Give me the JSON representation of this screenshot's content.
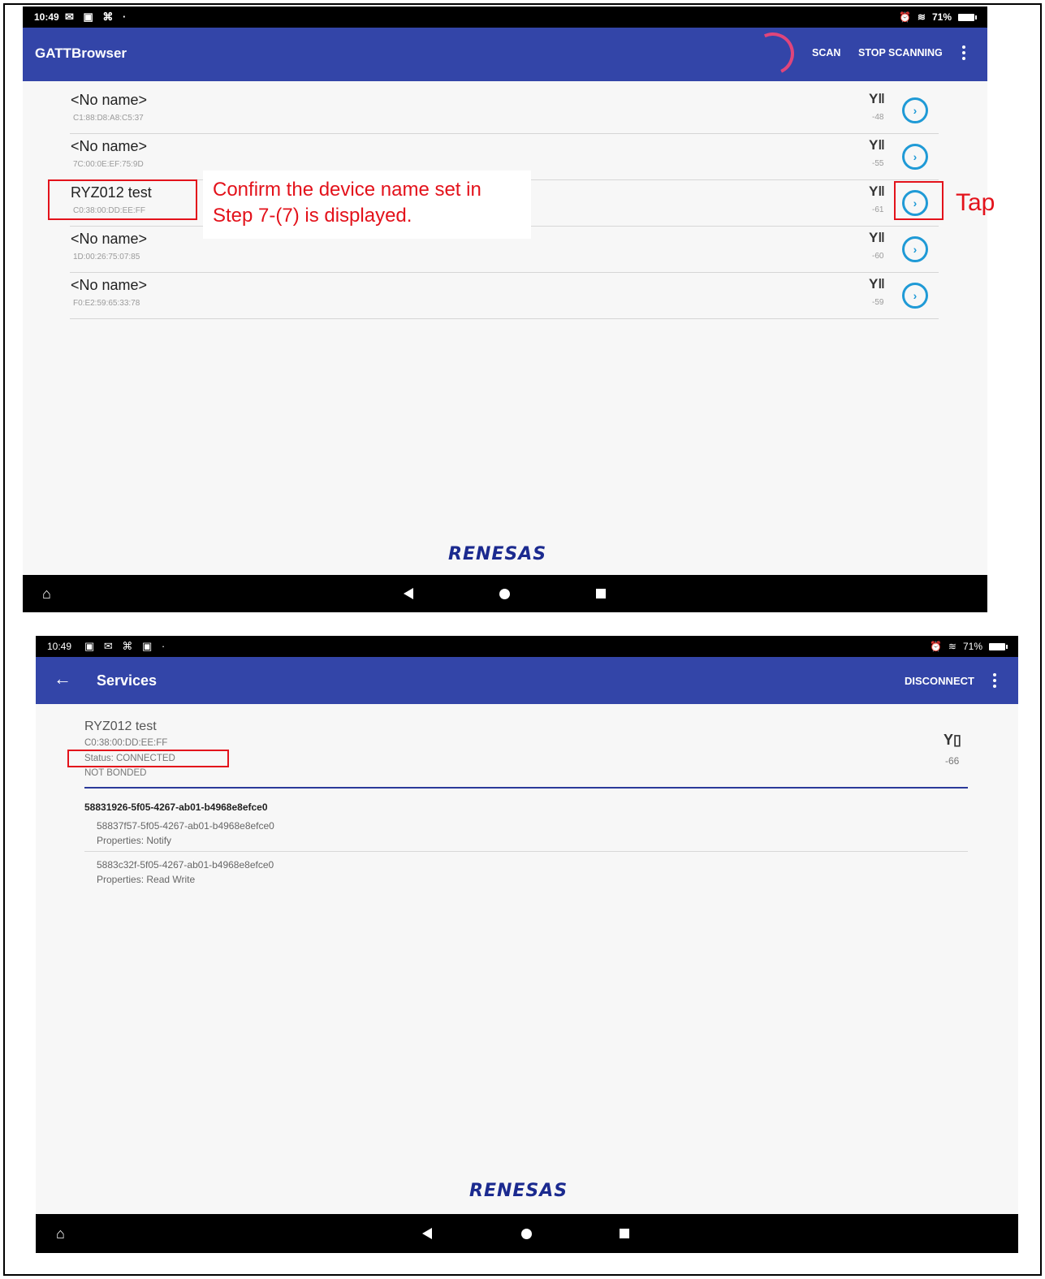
{
  "screen1": {
    "status_bar": {
      "time": "10:49",
      "battery": "71%"
    },
    "app_bar": {
      "title": "GATTBrowser",
      "scan": "SCAN",
      "stop_scanning": "STOP SCANNING"
    },
    "devices": [
      {
        "name": "<No name>",
        "mac": "C1:88:D8:A8:C5:37",
        "rssi": "-48"
      },
      {
        "name": "<No name>",
        "mac": "7C:00:0E:EF:75:9D",
        "rssi": "-55"
      },
      {
        "name": "RYZ012 test",
        "mac": "C0:38:00:DD:EE:FF",
        "rssi": "-61"
      },
      {
        "name": "<No name>",
        "mac": "1D:00:26:75:07:85",
        "rssi": "-60"
      },
      {
        "name": "<No name>",
        "mac": "F0:E2:59:65:33:78",
        "rssi": "-59"
      }
    ],
    "logo": "RENESAS"
  },
  "annotations": {
    "confirm_line1": "Confirm the device name set in",
    "confirm_line2": "Step 7-(7) is displayed.",
    "tap": "Tap"
  },
  "screen2": {
    "status_bar": {
      "time": "10:49",
      "battery": "71%"
    },
    "app_bar": {
      "title": "Services",
      "disconnect": "DISCONNECT"
    },
    "device": {
      "name": "RYZ012 test",
      "mac": "C0:38:00:DD:EE:FF",
      "status": "Status:  CONNECTED",
      "bond": "NOT BONDED",
      "rssi": "-66"
    },
    "service": {
      "uuid": "58831926-5f05-4267-ab01-b4968e8efce0",
      "characteristics": [
        {
          "uuid": "58837f57-5f05-4267-ab01-b4968e8efce0",
          "properties": "Properties: Notify"
        },
        {
          "uuid": "5883c32f-5f05-4267-ab01-b4968e8efce0",
          "properties": "Properties: Read Write"
        }
      ]
    },
    "logo": "RENESAS"
  },
  "icons": {
    "signal": "signal-strength-icon",
    "go": "chevron-circle-icon",
    "back": "arrow-left-icon",
    "menu": "overflow-menu-icon",
    "home_key": "home-icon"
  },
  "colors": {
    "app_bar": "#3345a8",
    "annotation": "#e3121b",
    "go_icon": "#1f9ad6",
    "spinner": "#e0457b"
  }
}
